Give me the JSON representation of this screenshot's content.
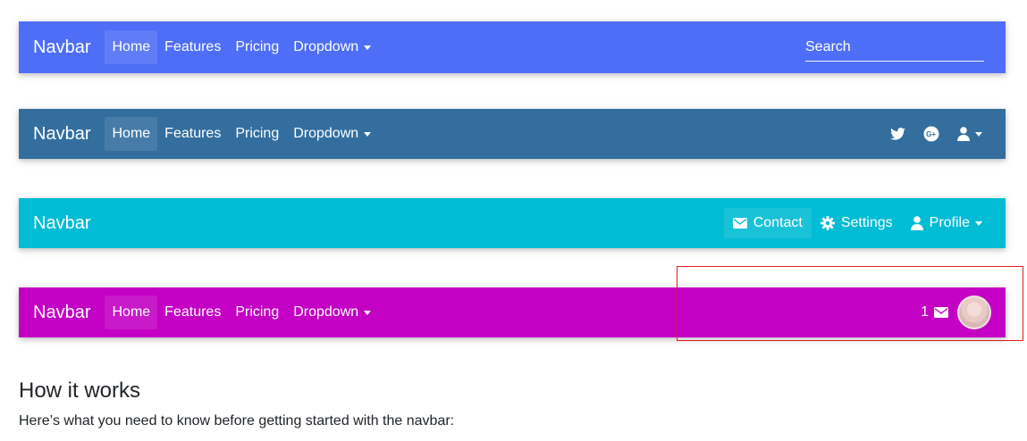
{
  "navbars": [
    {
      "brand": "Navbar",
      "color": "#4F6EF7",
      "items": [
        "Home",
        "Features",
        "Pricing",
        "Dropdown"
      ],
      "search": {
        "placeholder": "Search",
        "value": ""
      }
    },
    {
      "brand": "Navbar",
      "color": "#336E9F",
      "items": [
        "Home",
        "Features",
        "Pricing",
        "Dropdown"
      ],
      "right_icons": [
        "twitter-icon",
        "google-plus-icon",
        "user-icon"
      ]
    },
    {
      "brand": "Navbar",
      "color": "#00BCD4",
      "right_items": [
        "Contact",
        "Settings",
        "Profile"
      ]
    },
    {
      "brand": "Navbar",
      "color": "#C300C3",
      "items": [
        "Home",
        "Features",
        "Pricing",
        "Dropdown"
      ],
      "mail_count": "1"
    }
  ],
  "section": {
    "title": "How it works",
    "text": "Here’s what you need to know before getting started with the navbar:"
  },
  "highlight_color": "#E01B1B"
}
